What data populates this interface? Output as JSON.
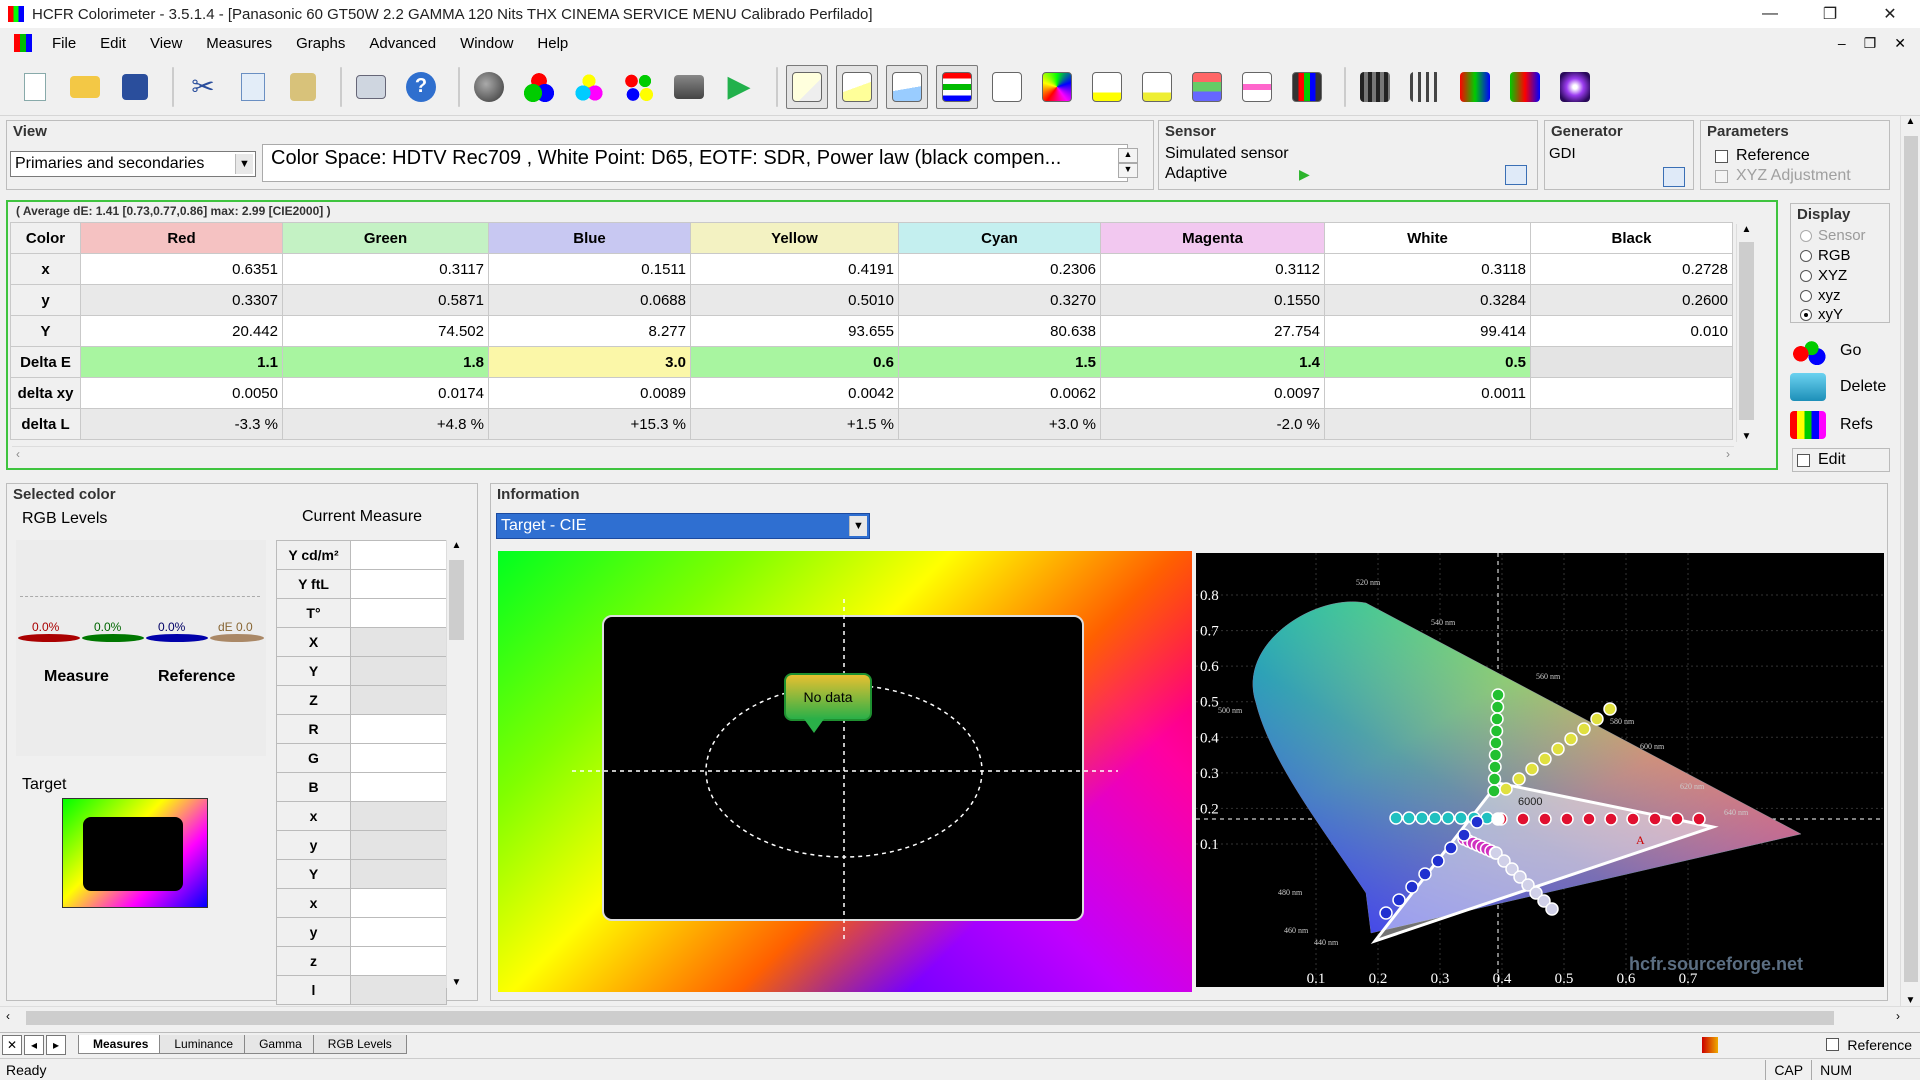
{
  "window": {
    "title": "HCFR Colorimeter - 3.5.1.4 - [Panasonic 60 GT50W 2.2 GAMMA 120 Nits THX CINEMA SERVICE MENU Calibrado Perfilado]",
    "min": "—",
    "max": "❐",
    "close": "✕"
  },
  "menu": {
    "items": [
      "File",
      "Edit",
      "View",
      "Measures",
      "Graphs",
      "Advanced",
      "Window",
      "Help"
    ],
    "mdi_min": "–",
    "mdi_restore": "❐",
    "mdi_close": "✕"
  },
  "view_panel": {
    "label": "View",
    "mode": "Primaries and secondaries",
    "info": "Color Space: HDTV Rec709 , White Point: D65, EOTF:  SDR, Power law (black compen..."
  },
  "sensor_panel": {
    "label": "Sensor",
    "name": "Simulated sensor",
    "mode": "Adaptive"
  },
  "generator_panel": {
    "label": "Generator",
    "name": "GDI"
  },
  "parameters_panel": {
    "label": "Parameters",
    "reference": "Reference",
    "xyz_adjustment": "XYZ Adjustment"
  },
  "display_panel": {
    "label": "Display",
    "options": [
      "Sensor",
      "RGB",
      "XYZ",
      "xyz",
      "xyY"
    ],
    "selected": "xyY"
  },
  "side_buttons": {
    "go": "Go",
    "delete": "Delete",
    "refs": "Refs",
    "edit": "Edit"
  },
  "average_de": "( Average dE: 1.41 [0.73,0.77,0.86] max: 2.99 [CIE2000] )",
  "grid": {
    "corner": "Color",
    "columns": [
      {
        "name": "Red",
        "color": "#f5c2c2"
      },
      {
        "name": "Green",
        "color": "#c4f2c4"
      },
      {
        "name": "Blue",
        "color": "#c8c8f2"
      },
      {
        "name": "Yellow",
        "color": "#f3f2c2"
      },
      {
        "name": "Cyan",
        "color": "#c4efef"
      },
      {
        "name": "Magenta",
        "color": "#f2c8f0"
      },
      {
        "name": "White",
        "color": "#ffffff"
      },
      {
        "name": "Black",
        "color": "#ffffff"
      }
    ],
    "rows": [
      {
        "label": "x",
        "values": [
          "0.6351",
          "0.3117",
          "0.1511",
          "0.4191",
          "0.2306",
          "0.3112",
          "0.3118",
          "0.2728"
        ]
      },
      {
        "label": "y",
        "values": [
          "0.3307",
          "0.5871",
          "0.0688",
          "0.5010",
          "0.3270",
          "0.1550",
          "0.3284",
          "0.2600"
        ]
      },
      {
        "label": "Y",
        "values": [
          "20.442",
          "74.502",
          "8.277",
          "93.655",
          "80.638",
          "27.754",
          "99.414",
          "0.010"
        ]
      },
      {
        "label": "Delta E",
        "values": [
          "1.1",
          "1.8",
          "3.0",
          "0.6",
          "1.5",
          "1.4",
          "0.5",
          ""
        ]
      },
      {
        "label": "delta xy",
        "values": [
          "0.0050",
          "0.0174",
          "0.0089",
          "0.0042",
          "0.0062",
          "0.0097",
          "0.0011",
          ""
        ]
      },
      {
        "label": "delta L",
        "values": [
          "-3.3 %",
          "+4.8 %",
          "+15.3 %",
          "+1.5 %",
          "+3.0 %",
          "-2.0 %",
          "",
          ""
        ]
      }
    ]
  },
  "selected_color": {
    "label": "Selected color",
    "rgb_levels": "RGB Levels",
    "current_measure": "Current Measure",
    "levels": [
      "0.0%",
      "0.0%",
      "0.0%",
      "dE 0.0"
    ],
    "measure": "Measure",
    "reference": "Reference",
    "target": "Target",
    "measure_rows": [
      "Y cd/m²",
      "Y ftL",
      "T°",
      "X",
      "Y",
      "Z",
      "R",
      "G",
      "B",
      "x",
      "y",
      "Y",
      "x",
      "y",
      "z",
      "l"
    ]
  },
  "information": {
    "label": "Information",
    "mode": "Target - CIE",
    "no_data": "No data",
    "watermark": "hcfr.sourceforge.net",
    "cie_y_ticks": [
      "0.8",
      "0.7",
      "0.6",
      "0.5",
      "0.4",
      "0.3",
      "0.2",
      "0.1"
    ],
    "cie_x_ticks": [
      "0.1",
      "0.2",
      "0.3",
      "0.4",
      "0.5",
      "0.6",
      "0.7"
    ],
    "wavelengths": [
      "520 nm",
      "540 nm",
      "560 nm",
      "580 nm",
      "600 nm",
      "620 nm",
      "640 nm",
      "500 nm",
      "480 nm",
      "460 nm",
      "440 nm"
    ],
    "white_label": "6000",
    "a_label": "A"
  },
  "tabs": [
    "Measures",
    "Luminance",
    "Gamma",
    "RGB Levels"
  ],
  "active_tab": "Measures",
  "status": {
    "text": "Ready",
    "reference": "Reference",
    "cap": "CAP",
    "num": "NUM"
  }
}
